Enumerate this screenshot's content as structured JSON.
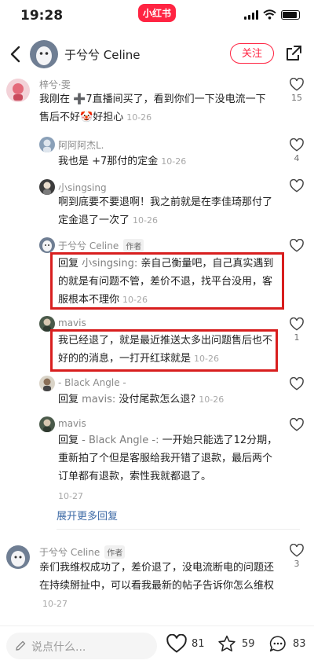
{
  "status_bar": {
    "time": "19:28",
    "brand": "小红书"
  },
  "header": {
    "author_name": "于兮兮 Celine",
    "follow_label": "关注"
  },
  "comments": [
    {
      "author": "梓兮·雯",
      "text": "我刚在 ➕7直播间买了，看到你们一下没电流一下售后不好",
      "emoji": "🤡",
      "text_tail": "好担心",
      "date": "10-26",
      "likes": "15"
    },
    {
      "author": "阿阿阿杰L.",
      "text": "我也是 +7那付的定金",
      "date": "10-26",
      "likes": "4"
    },
    {
      "author": "小singsing",
      "text": "啊到底要不要退啊！我之前就是在李佳琦那付了定金退了一次了",
      "date": "10-26",
      "likes": ""
    },
    {
      "author": "于兮兮 Celine",
      "badge": "作者",
      "reply_prefix": "回复 ",
      "reply_to": "小singsing:",
      "text": " 亲自己衡量吧，自己真实遇到的就是有问题不管，差价不退，找平台没用，客服根本不理你",
      "date": "10-26",
      "likes": ""
    },
    {
      "author": "mavis",
      "text": "我已经退了，就是最近推送太多出问题售后也不好的的消息，一打开红球就是",
      "date": "10-26",
      "likes": "1"
    },
    {
      "author": "- Black Angle -",
      "reply_prefix": "回复 ",
      "reply_to": "mavis:",
      "text": " 没付尾款怎么退?",
      "date": "10-26",
      "likes": ""
    },
    {
      "author": "mavis",
      "reply_prefix": "回复 ",
      "reply_to": "- Black Angle -:",
      "text": " 一开始只能选了12分期，重新拍了个但是客服给我开错了退款，最后两个订单都有退款，索性我就都退了。",
      "date": "10-27",
      "likes": ""
    },
    {
      "author": "于兮兮 Celine",
      "badge": "作者",
      "text": "亲们我维权成功了，差价退了，没电流断电的问题还在持续掰扯中，可以看我最新的帖子告诉你怎么维权",
      "date": "10-27",
      "likes": "3"
    }
  ],
  "expand_more": "展开更多回复",
  "bottom_bar": {
    "input_placeholder": "说点什么...",
    "likes": "81",
    "collects": "59",
    "comments": "83"
  },
  "colors": {
    "accent": "#ff2442",
    "highlight_box": "#d81e1e",
    "link": "#3d6aa6"
  }
}
